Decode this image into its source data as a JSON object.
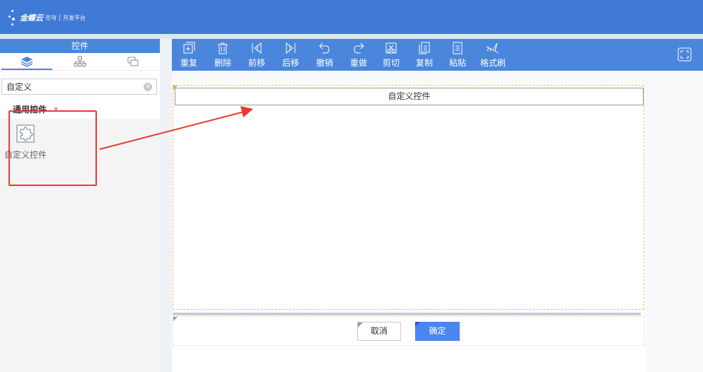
{
  "app": {
    "brand": "金蝶云",
    "brand_sub": "苍穹",
    "platform": "开发平台"
  },
  "left_panel": {
    "header": "控件",
    "tabs": [
      {
        "icon": "layers-icon",
        "active": true
      },
      {
        "icon": "org-tree-icon",
        "active": false
      },
      {
        "icon": "window-icon",
        "active": false
      }
    ],
    "search": {
      "value": "自定义"
    },
    "group_label": "通用控件",
    "widgets": [
      {
        "label": "自定义控件",
        "icon": "puzzle-icon"
      }
    ]
  },
  "toolbar": {
    "buttons": [
      {
        "label": "重复",
        "icon": "repeat-icon"
      },
      {
        "label": "删除",
        "icon": "trash-icon"
      },
      {
        "label": "前移",
        "icon": "move-forward-icon"
      },
      {
        "label": "后移",
        "icon": "move-backward-icon"
      },
      {
        "label": "撤销",
        "icon": "undo-icon"
      },
      {
        "label": "重做",
        "icon": "redo-icon"
      },
      {
        "label": "剪切",
        "icon": "cut-icon"
      },
      {
        "label": "复制",
        "icon": "copy-icon"
      },
      {
        "label": "粘贴",
        "icon": "paste-icon"
      },
      {
        "label": "格式刷",
        "icon": "format-brush-icon"
      }
    ],
    "expand_icon": "fullscreen-icon"
  },
  "canvas": {
    "control_title": "自定义控件",
    "cancel_label": "取消",
    "ok_label": "确定"
  },
  "colors": {
    "header_blue": "#3f7bd6",
    "toolbar_blue": "#4a86dc",
    "annotation_red": "#e83a2e",
    "ok_button": "#4a86f0"
  }
}
